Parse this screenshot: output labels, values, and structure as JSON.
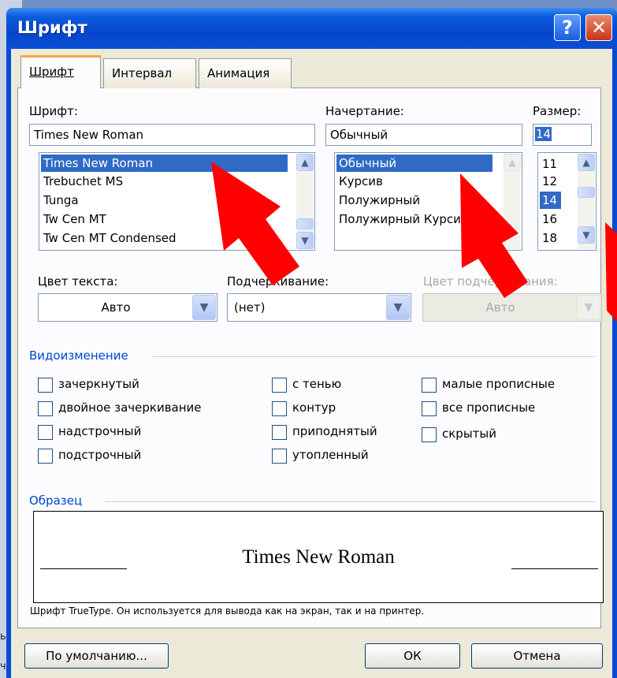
{
  "dialog": {
    "title": "Шрифт",
    "help_label": "?",
    "close_label": "✕"
  },
  "tabs": [
    {
      "label": "Шрифт",
      "active": true
    },
    {
      "label": "Интервал",
      "active": false
    },
    {
      "label": "Анимация",
      "active": false
    }
  ],
  "font": {
    "label": "Шрифт:",
    "value": "Times New Roman",
    "items": [
      "Times New Roman",
      "Trebuchet MS",
      "Tunga",
      "Tw Cen MT",
      "Tw Cen MT Condensed"
    ],
    "selected": "Times New Roman"
  },
  "style": {
    "label": "Начертание:",
    "value": "Обычный",
    "items": [
      "Обычный",
      "Курсив",
      "Полужирный",
      "Полужирный Курсив"
    ],
    "selected": "Обычный"
  },
  "size": {
    "label": "Размер:",
    "value": "14",
    "items": [
      "11",
      "12",
      "14",
      "16",
      "18"
    ],
    "selected": "14"
  },
  "color": {
    "label": "Цвет текста:",
    "value": "Авто"
  },
  "underline": {
    "label": "Подчеркивание:",
    "value": "(нет)"
  },
  "underline_color": {
    "label": "Цвет подчеркивания:",
    "value": "Авто",
    "enabled": false
  },
  "effects": {
    "title": "Видоизменение",
    "col1": [
      "зачеркнутый",
      "двойное зачеркивание",
      "надстрочный",
      "подстрочный"
    ],
    "col2": [
      "с тенью",
      "контур",
      "приподнятый",
      "утопленный"
    ],
    "col3": [
      "малые прописные",
      "все прописные",
      "скрытый"
    ]
  },
  "sample": {
    "title": "Образец",
    "text": "Times New Roman",
    "note": "Шрифт TrueType. Он используется для вывода как на экран, так и на принтер."
  },
  "buttons": {
    "default": "По умолчанию...",
    "ok": "ОК",
    "cancel": "Отмена"
  },
  "background_fragments": [
    "ь",
    "ч"
  ],
  "colors": {
    "accent": "#316ac5",
    "title_bar": "#0a4ad6",
    "arrow": "#ff0000",
    "group_title": "#0046d5"
  }
}
